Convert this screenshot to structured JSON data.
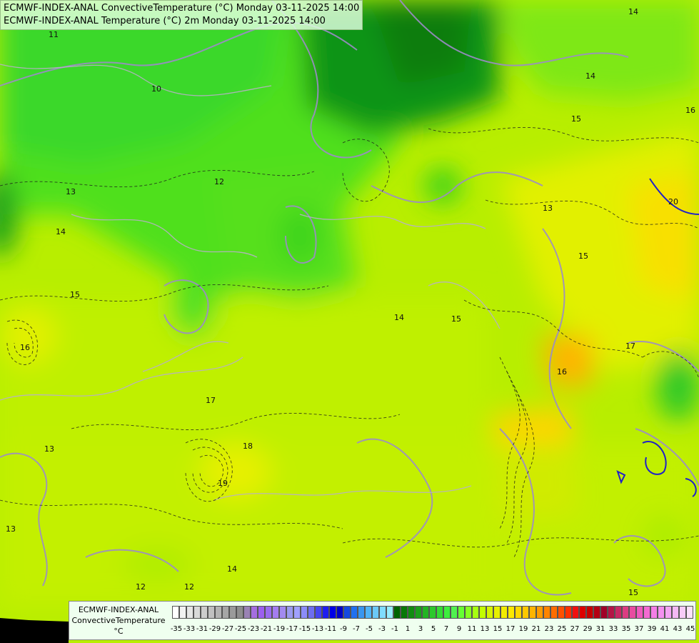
{
  "title_lines": [
    "ECMWF-INDEX-ANAL ConvectiveTemperature (°C) Monday 03-11-2025 14:00",
    "ECMWF-INDEX-ANAL Temperature (°C) 2m Monday 03-11-2025 14:00"
  ],
  "contour_labels": [
    "11",
    "10",
    "12",
    "13",
    "14",
    "15",
    "16",
    "17",
    "18",
    "19",
    "20",
    "13",
    "12",
    "14",
    "15",
    "13",
    "15",
    "16",
    "17",
    "14",
    "13",
    "12",
    "14",
    "15",
    "16",
    "14",
    "15"
  ],
  "legend": {
    "title_lines": [
      "ECMWF-INDEX-ANAL",
      "ConvectiveTemperature",
      "°C"
    ],
    "ticks": [
      "-35",
      "-33",
      "-31",
      "-29",
      "-27",
      "-25",
      "-23",
      "-21",
      "-19",
      "-17",
      "-15",
      "-13",
      "-11",
      "-9",
      "-7",
      "-5",
      "-3",
      "-1",
      "1",
      "3",
      "5",
      "7",
      "9",
      "11",
      "13",
      "15",
      "17",
      "19",
      "21",
      "23",
      "25",
      "27",
      "29",
      "31",
      "33",
      "35",
      "37",
      "39",
      "41",
      "43",
      "45"
    ],
    "colors": [
      "#ffffff",
      "#f2f2f2",
      "#e6e6e6",
      "#d9d9d9",
      "#cccccc",
      "#c0c0c0",
      "#b3b3b3",
      "#a6a6a6",
      "#9a9a9a",
      "#8d8d8d",
      "#9a82b4",
      "#a56ee0",
      "#9c5ff0",
      "#9a6cf0",
      "#a47cf0",
      "#a28af0",
      "#9a9af0",
      "#a0a0ff",
      "#8c8cf8",
      "#6e6ef0",
      "#4646f0",
      "#1e1ef0",
      "#0000e6",
      "#0000c8",
      "#1448e0",
      "#2070f0",
      "#3896f0",
      "#50b4f8",
      "#6cc8f8",
      "#80dcff",
      "#98ecff",
      "#006400",
      "#087808",
      "#108c10",
      "#1aa01a",
      "#22b422",
      "#2cc82c",
      "#34dc34",
      "#3eee3e",
      "#50f050",
      "#66ff33",
      "#88ff22",
      "#a6ff11",
      "#c2ff00",
      "#d6f500",
      "#e6f000",
      "#f2ec00",
      "#fce800",
      "#ffd800",
      "#ffc800",
      "#ffb400",
      "#ff9c00",
      "#ff8400",
      "#ff6c00",
      "#ff5000",
      "#ff3000",
      "#f01010",
      "#dc0000",
      "#c80000",
      "#b40014",
      "#a00028",
      "#b41446",
      "#c82864",
      "#dc3c82",
      "#e84ca0",
      "#f05abe",
      "#f46ad2",
      "#f47ee6",
      "#f490f0",
      "#f4a4f4",
      "#f4b8f4",
      "#f8ccf8",
      "#fce0fc"
    ]
  }
}
